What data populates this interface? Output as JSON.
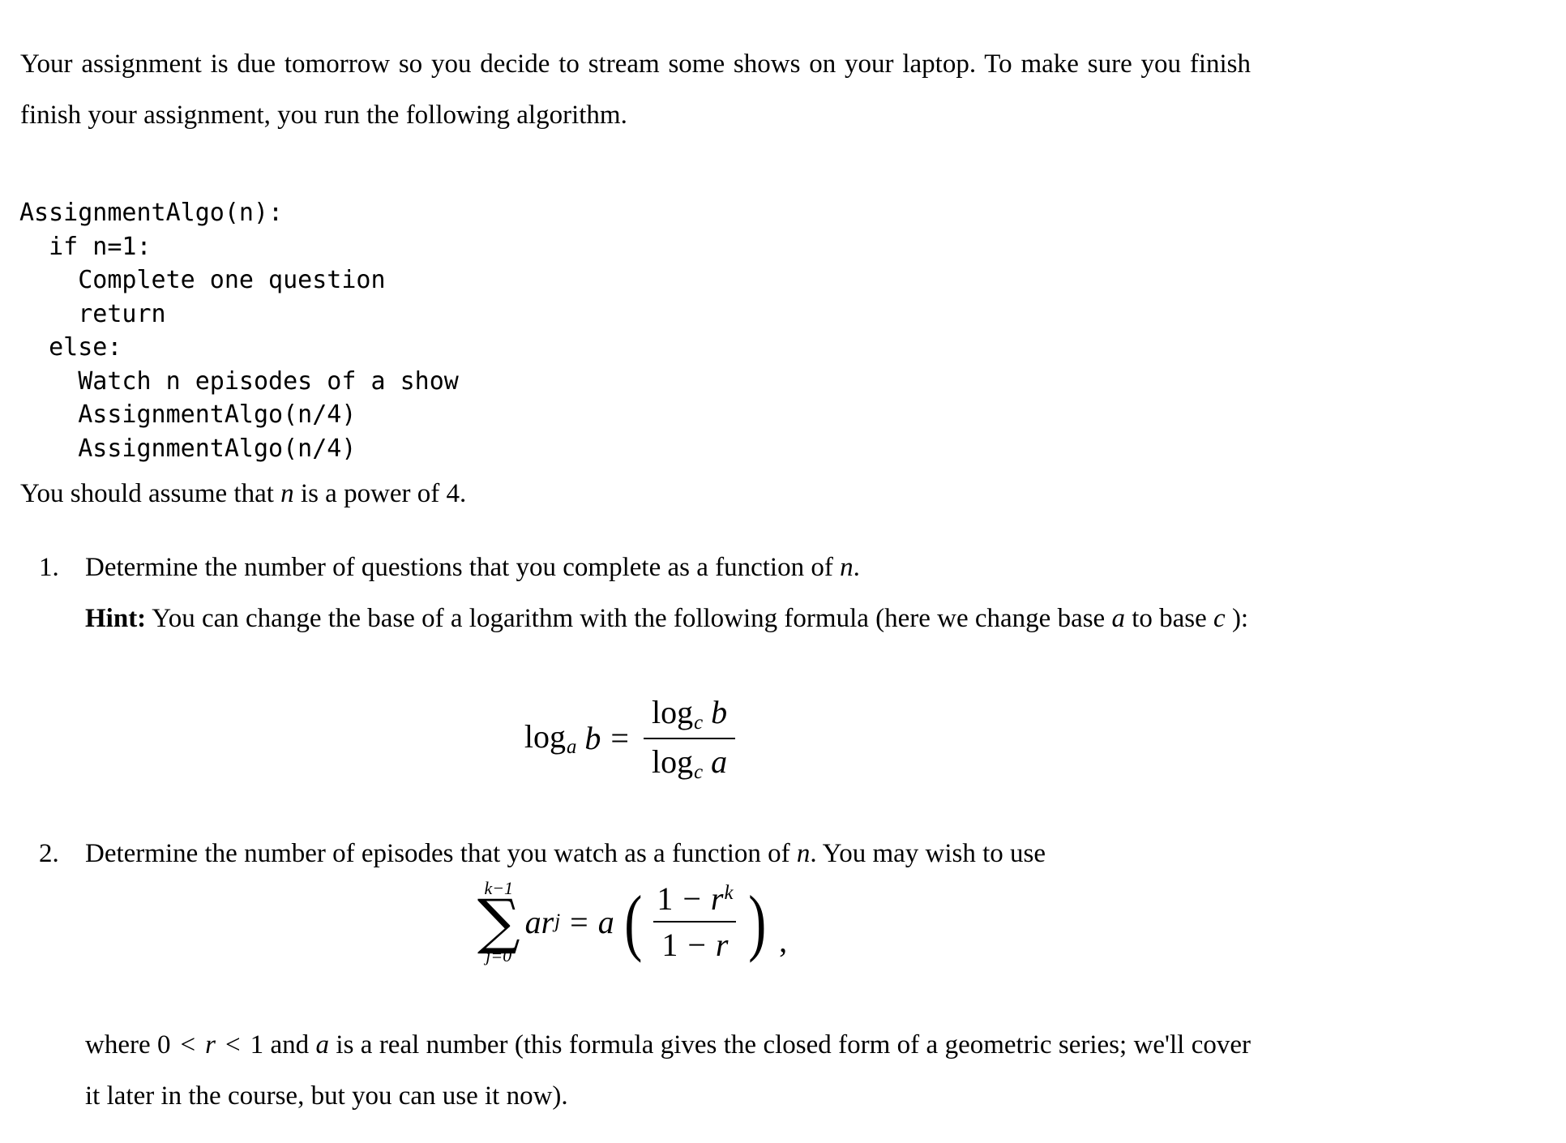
{
  "document": {
    "intro": {
      "line1": "Your assignment is due tomorrow so you decide to stream some shows on your laptop. To make",
      "line2": "sure you finish finish your assignment, you run the following algorithm.",
      "full": "Your assignment is due tomorrow so you decide to stream some shows on your laptop. To make sure you finish finish your assignment, you run the following algorithm."
    },
    "code_block": {
      "language": "pseudocode",
      "lines": [
        "AssignmentAlgo(n):",
        "  if n=1:",
        "    Complete one question",
        "    return",
        "  else:",
        "    Watch n episodes of a show",
        "    AssignmentAlgo(n/4)",
        "    AssignmentAlgo(n/4)"
      ],
      "text": "AssignmentAlgo(n):\n  if n=1:\n    Complete one question\n    return\n  else:\n    Watch n episodes of a show\n    AssignmentAlgo(n/4)\n    AssignmentAlgo(n/4)"
    },
    "assumption": {
      "before_var": "You should assume that ",
      "variable": "n",
      "after_var": " is a power of ",
      "number": "4",
      "period": "."
    },
    "items": [
      {
        "marker": "1.",
        "question": {
          "before_var": "Determine the number of questions that you complete as a function of ",
          "variable": "n",
          "after_var": "."
        },
        "hint": {
          "label": "Hint:",
          "text_part1": " You can change the base of a logarithm with the following formula (here we change base ",
          "var_a": "a",
          "text_part2": " to base ",
          "var_c": "c",
          "text_part3": " ):"
        },
        "formula": {
          "id": "change-of-base",
          "latex": "\\log_a b = \\frac{\\log_c b}{\\log_c a}",
          "lhs_log": "log",
          "lhs_sub": "a",
          "lhs_arg": "b",
          "equals": "=",
          "num_log": "log",
          "num_sub": "c",
          "num_arg": "b",
          "den_log": "log",
          "den_sub": "c",
          "den_arg": "a"
        }
      },
      {
        "marker": "2.",
        "question": {
          "before_var": "Determine the number of episodes that you watch as a function of ",
          "variable": "n",
          "after_var": ". You may wish to use"
        },
        "formula": {
          "id": "geometric-series",
          "latex": "\\sum_{j=0}^{k-1} ar^j = a\\left(\\frac{1-r^k}{1-r}\\right),",
          "sum_upper": "k−1",
          "sum_symbol": "∑",
          "sum_lower": "j=0",
          "summand_a": "a",
          "summand_r": "r",
          "summand_exp": "j",
          "equals": "=",
          "rhs_a": "a",
          "paren_open": "(",
          "num_one": "1",
          "num_minus": "−",
          "num_r": "r",
          "num_exp": "k",
          "den_one": "1",
          "den_minus": "−",
          "den_r": "r",
          "paren_close": ")",
          "trailing_comma": ","
        },
        "closing": {
          "before": "where ",
          "ineq_zero": "0",
          "lt1": "<",
          "var_r": "r",
          "lt2": "<",
          "one": "1",
          "mid": " and ",
          "var_a": "a",
          "after": " is a real number (this formula gives the closed form of a geometric series; we'll cover it later in the course, but you can use it now)."
        }
      }
    ]
  }
}
